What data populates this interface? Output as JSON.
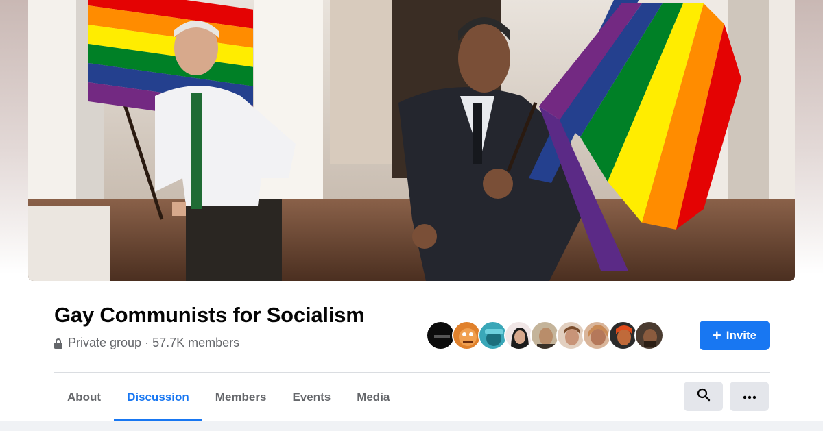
{
  "cover": {
    "description_icon": "cover-photo"
  },
  "group": {
    "name": "Gay Communists for Socialism",
    "privacy": "Private group",
    "separator": "·",
    "members": "57.7K members"
  },
  "actions": {
    "invite_label": "Invite",
    "invite_icon": "plus-icon"
  },
  "tabs": [
    {
      "label": "About"
    },
    {
      "label": "Discussion"
    },
    {
      "label": "Members"
    },
    {
      "label": "Events"
    },
    {
      "label": "Media"
    }
  ],
  "colors": {
    "accent": "#1877f2",
    "title": "#050505",
    "secondary_text": "#65676b",
    "button_gray": "#e4e6eb"
  }
}
